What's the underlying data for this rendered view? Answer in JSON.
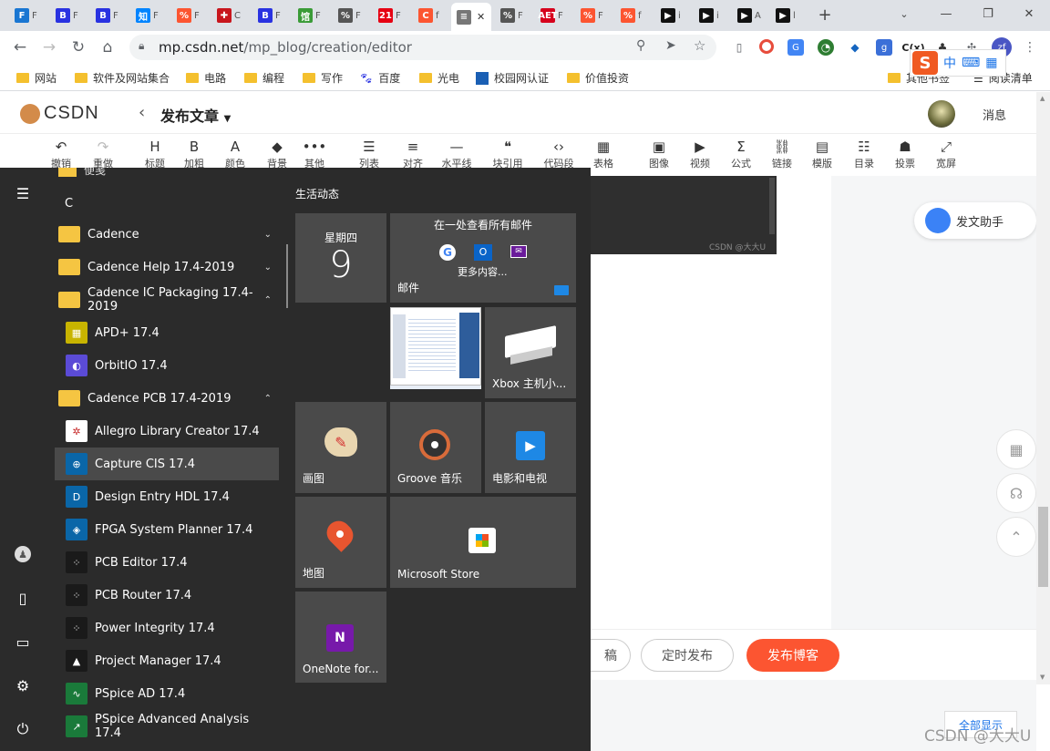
{
  "tabs": [
    {
      "fav": "F",
      "title": "F",
      "color": "#1976d2"
    },
    {
      "fav": "B",
      "title": "F",
      "color": "#2932e1"
    },
    {
      "fav": "B",
      "title": "F",
      "color": "#2932e1"
    },
    {
      "fav": "知",
      "title": "F",
      "color": "#0084ff"
    },
    {
      "fav": "%",
      "title": "F",
      "color": "#fc5531"
    },
    {
      "fav": "✚",
      "title": "C",
      "color": "#c8161d"
    },
    {
      "fav": "B",
      "title": "F",
      "color": "#2932e1"
    },
    {
      "fav": "馆",
      "title": "F",
      "color": "#3a9b37"
    },
    {
      "fav": "%",
      "title": "F",
      "color": "#555555"
    },
    {
      "fav": "21",
      "title": "F",
      "color": "#e60012"
    },
    {
      "fav": "C",
      "title": "f",
      "color": "#fc5531"
    },
    {
      "fav": "≡",
      "title": "",
      "color": "#777777"
    },
    {
      "fav": "%",
      "title": "F",
      "color": "#555555"
    },
    {
      "fav": "AET",
      "title": "F",
      "color": "#d6001c"
    },
    {
      "fav": "%",
      "title": "F",
      "color": "#fc5531"
    },
    {
      "fav": "%",
      "title": "f",
      "color": "#fc5531"
    },
    {
      "fav": "▶",
      "title": "i",
      "color": "#111111"
    },
    {
      "fav": "▶",
      "title": "i",
      "color": "#111111"
    },
    {
      "fav": "▶",
      "title": "A",
      "color": "#111111"
    },
    {
      "fav": "▶",
      "title": "l",
      "color": "#111111"
    }
  ],
  "toolbar": {
    "url_host": "mp.csdn.net",
    "url_path": "/mp_blog/creation/editor",
    "profile": "zf"
  },
  "bookmarks": [
    {
      "label": "网站",
      "icon": "folder"
    },
    {
      "label": "软件及网站集合",
      "icon": "folder"
    },
    {
      "label": "电路",
      "icon": "folder"
    },
    {
      "label": "编程",
      "icon": "folder"
    },
    {
      "label": "写作",
      "icon": "folder"
    },
    {
      "label": "百度",
      "icon": "baidu"
    },
    {
      "label": "光电",
      "icon": "folder"
    },
    {
      "label": "校园网认证",
      "icon": "campus"
    },
    {
      "label": "价值投资",
      "icon": "folder"
    }
  ],
  "bookmarks_right": [
    "其他书签",
    "阅读清单"
  ],
  "ime": {
    "lang": "中"
  },
  "csdn": {
    "logo": "CSDN",
    "title": "发布文章",
    "messages": "消息",
    "assistant": "发文助手",
    "btn_draft": "稿",
    "btn_schedule": "定时发布",
    "btn_publish": "发布博客",
    "show_all": "全部显示",
    "watermark": "CSDN @大大U",
    "image_watermark": "CSDN @大大U"
  },
  "editor_tools": [
    {
      "icon": "↶",
      "label": "撤销"
    },
    {
      "icon": "↷",
      "label": "重做"
    },
    {
      "icon": "H",
      "label": "标题"
    },
    {
      "icon": "B",
      "label": "加粗"
    },
    {
      "icon": "A",
      "label": "颜色"
    },
    {
      "icon": "◆",
      "label": "背景"
    },
    {
      "icon": "•••",
      "label": "其他"
    },
    {
      "icon": "☰",
      "label": "列表"
    },
    {
      "icon": "≡",
      "label": "对齐"
    },
    {
      "icon": "—",
      "label": "水平线"
    },
    {
      "icon": "❝",
      "label": "块引用"
    },
    {
      "icon": "‹›",
      "label": "代码段"
    },
    {
      "icon": "▦",
      "label": "表格"
    },
    {
      "icon": "▣",
      "label": "图像"
    },
    {
      "icon": "▶",
      "label": "视频"
    },
    {
      "icon": "Σ",
      "label": "公式"
    },
    {
      "icon": "⛓",
      "label": "链接"
    },
    {
      "icon": "▤",
      "label": "模版"
    },
    {
      "icon": "☷",
      "label": "目录"
    },
    {
      "icon": "☗",
      "label": "投票"
    },
    {
      "icon": "⤢",
      "label": "宽屏"
    }
  ],
  "startmenu": {
    "top_partial": "便笺",
    "letter": "C",
    "apps": [
      {
        "label": "Cadence",
        "type": "folder",
        "chev": "⌄"
      },
      {
        "label": "Cadence Help 17.4-2019",
        "type": "folder",
        "chev": "⌄"
      },
      {
        "label": "Cadence IC Packaging 17.4-2019",
        "type": "folder",
        "chev": "⌃"
      },
      {
        "label": "APD+ 17.4",
        "type": "app",
        "glyph": "▦",
        "color": "#c8b400"
      },
      {
        "label": "OrbitIO 17.4",
        "type": "app",
        "glyph": "◐",
        "color": "#5b4bd6"
      },
      {
        "label": "Cadence PCB 17.4-2019",
        "type": "folder",
        "chev": "⌃"
      },
      {
        "label": "Allegro Library Creator 17.4",
        "type": "app",
        "glyph": "✲",
        "color": "#ffffff"
      },
      {
        "label": "Capture CIS 17.4",
        "type": "app",
        "glyph": "⊕",
        "color": "#0a66a8"
      },
      {
        "label": "Design Entry HDL 17.4",
        "type": "app",
        "glyph": "D",
        "color": "#0a66a8"
      },
      {
        "label": "FPGA System Planner 17.4",
        "type": "app",
        "glyph": "◈",
        "color": "#0a66a8"
      },
      {
        "label": "PCB Editor 17.4",
        "type": "app",
        "glyph": "⁘",
        "color": "#1a1a1a"
      },
      {
        "label": "PCB Router 17.4",
        "type": "app",
        "glyph": "⁘",
        "color": "#1a1a1a"
      },
      {
        "label": "Power Integrity 17.4",
        "type": "app",
        "glyph": "⁘",
        "color": "#1a1a1a"
      },
      {
        "label": "Project Manager 17.4",
        "type": "app",
        "glyph": "▲",
        "color": "#1a1a1a"
      },
      {
        "label": "PSpice AD 17.4",
        "type": "app",
        "glyph": "∿",
        "color": "#1a7a3a"
      },
      {
        "label": "PSpice Advanced Analysis 17.4",
        "type": "app",
        "glyph": "↗",
        "color": "#1a7a3a"
      }
    ],
    "group_title": "生活动态",
    "calendar": {
      "weekday": "星期四",
      "day": "9"
    },
    "mail": {
      "header": "在一处查看所有邮件",
      "more": "更多内容...",
      "label": "邮件"
    },
    "tiles": {
      "xbox": "Xbox 主机小...",
      "paint": "画图",
      "groove": "Groove 音乐",
      "movies": "电影和电视",
      "maps": "地图",
      "store": "Microsoft Store",
      "onenote": "OneNote for..."
    }
  }
}
